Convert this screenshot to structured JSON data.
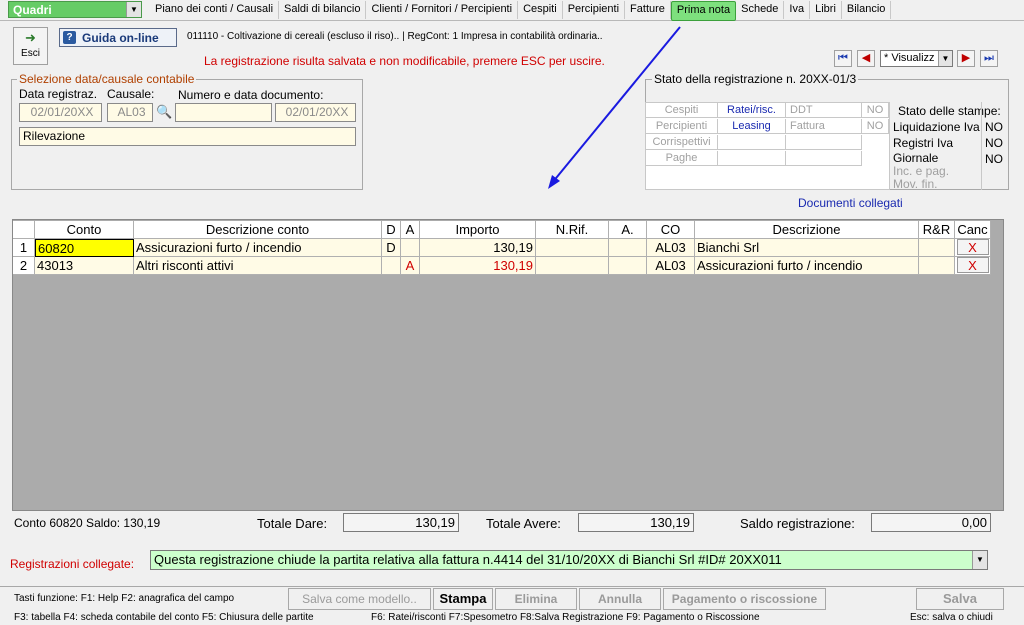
{
  "top": {
    "combo_value": "Quadri",
    "menu": [
      "Piano dei conti / Causali",
      "Saldi di bilancio",
      "Clienti / Fornitori / Percipienti",
      "Cespiti",
      "Percipienti",
      "Fatture",
      "Prima nota",
      "Schede",
      "Iva",
      "Libri",
      "Bilancio"
    ],
    "active_menu": "Prima nota"
  },
  "toolbar": {
    "esci_label": "Esci",
    "guida_label": "Guida on-line",
    "info_text": "011110 - Coltivazione di cereali (escluso il riso)..  | RegCont: 1 Impresa  in contabilità ordinaria..",
    "warning": "La registrazione risulta salvata e non modificabile, premere ESC per uscire.",
    "view_mode": "* Visualizz"
  },
  "selezione": {
    "legend": "Selezione data/causale contabile",
    "data_label": "Data registraz.",
    "causale_label": "Causale:",
    "numero_label": "Numero e data documento:",
    "data_value": "02/01/20XX",
    "causale_value": "AL03",
    "numero_value": "",
    "data_doc_value": "02/01/20XX",
    "descrizione": "Rilevazione"
  },
  "stato": {
    "title": "Stato della registrazione n. 20XX-01/3",
    "rows": [
      [
        "Cespiti",
        "Ratei/risc.",
        "DDT",
        "NO"
      ],
      [
        "Percipienti",
        "Leasing",
        "Fattura",
        "NO"
      ],
      [
        "Corrispettivi",
        "",
        "",
        ""
      ],
      [
        "Paghe",
        "",
        "",
        ""
      ]
    ],
    "stampe_title": "Stato delle stampe:",
    "stampe": [
      {
        "label": "Liquidazione Iva",
        "value": "NO"
      },
      {
        "label": "Registri Iva",
        "value": "NO"
      },
      {
        "label": "Giornale",
        "value": "NO"
      },
      {
        "label": "Inc. e pag.",
        "value": ""
      },
      {
        "label": "Mov. fin.",
        "value": ""
      }
    ]
  },
  "documenti_link": "Documenti collegati",
  "grid": {
    "headers": [
      "",
      "Conto",
      "Descrizione conto",
      "D",
      "A",
      "Importo",
      "N.Rif.",
      "A.",
      "CO",
      "Descrizione",
      "R&R",
      "Canc"
    ],
    "rows": [
      {
        "n": "1",
        "conto": "60820",
        "descr": "Assicurazioni furto / incendio",
        "d": "D",
        "a": "",
        "importo": "130,19",
        "nrif": "",
        "aa": "",
        "co": "AL03",
        "descrizione": "Bianchi Srl",
        "rr": "",
        "canc": "X"
      },
      {
        "n": "2",
        "conto": "43013",
        "descr": "Altri risconti attivi",
        "d": "",
        "a": "A",
        "importo": "130,19",
        "nrif": "",
        "aa": "",
        "co": "AL03",
        "descrizione": "Assicurazioni furto / incendio",
        "rr": "",
        "canc": "X"
      }
    ]
  },
  "totals": {
    "saldo_conto": "Conto 60820 Saldo: 130,19",
    "dare_label": "Totale Dare:",
    "dare_value": "130,19",
    "avere_label": "Totale Avere:",
    "avere_value": "130,19",
    "saldo_label": "Saldo registrazione:",
    "saldo_value": "0,00"
  },
  "collegate": {
    "label": "Registrazioni collegate:",
    "value": "Questa registrazione chiude la partita relativa alla fattura n.4414 del 31/10/20XX di Bianchi Srl  #ID# 20XX011"
  },
  "footer": {
    "line1": "Tasti funzione:  F1: Help   F2: anagrafica del campo",
    "line2": "F3: tabella    F4: scheda contabile del conto   F5: Chiusura delle partite",
    "line3": "F6: Ratei/risconti    F7:Spesometro    F8:Salva Registrazione     F9: Pagamento o Riscossione",
    "line4": "Esc: salva o chiudi",
    "buttons": {
      "salva_modello": "Salva come modello..",
      "stampa": "Stampa",
      "elimina": "Elimina",
      "annulla": "Annulla",
      "pagamento": "Pagamento o riscossione",
      "salva": "Salva"
    }
  },
  "colors": {
    "accent_green": "#66cc66",
    "active_tab": "#7ee07e",
    "warning_red": "#d00000",
    "link_blue": "#1a2ab0",
    "grid_bg": "#ababab",
    "collegate_bg": "#ccffcc"
  }
}
